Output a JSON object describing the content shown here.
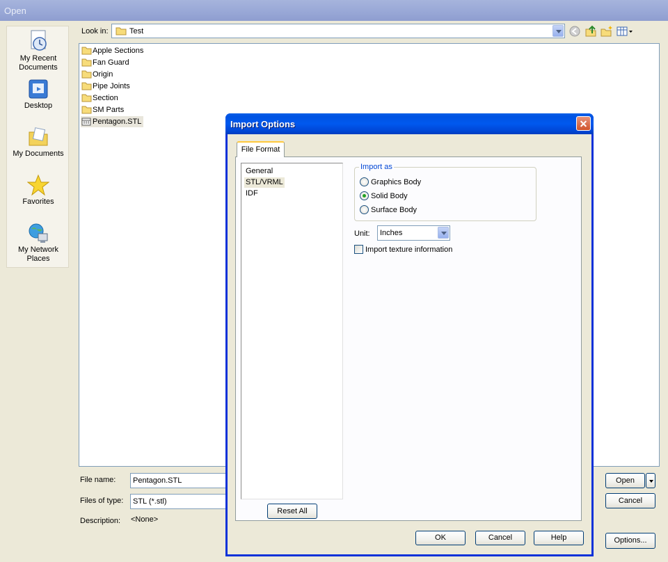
{
  "open_dialog": {
    "title": "Open",
    "places": [
      {
        "label": "My Recent Documents",
        "icon": "recent-documents-icon"
      },
      {
        "label": "Desktop",
        "icon": "desktop-icon"
      },
      {
        "label": "My Documents",
        "icon": "my-documents-icon"
      },
      {
        "label": "Favorites",
        "icon": "favorites-star-icon"
      },
      {
        "label": "My Network Places",
        "icon": "network-places-icon"
      }
    ],
    "look_in": {
      "label": "Look in:",
      "value": "Test"
    },
    "files": [
      {
        "name": "Apple Sections",
        "type": "folder"
      },
      {
        "name": "Fan Guard",
        "type": "folder"
      },
      {
        "name": "Origin",
        "type": "folder"
      },
      {
        "name": "Pipe Joints",
        "type": "folder"
      },
      {
        "name": "Section",
        "type": "folder"
      },
      {
        "name": "SM Parts",
        "type": "folder"
      },
      {
        "name": "Pentagon.STL",
        "type": "stl-file",
        "selected": true
      }
    ],
    "file_name": {
      "label": "File name:",
      "value": "Pentagon.STL"
    },
    "files_of_type": {
      "label": "Files of type:",
      "value": "STL (*.stl)"
    },
    "description": {
      "label": "Description:",
      "value": "<None>"
    },
    "buttons": {
      "open": "Open",
      "cancel": "Cancel",
      "options": "Options..."
    }
  },
  "import_options": {
    "title": "Import Options",
    "tab": "File Format",
    "categories": [
      {
        "label": "General",
        "selected": false
      },
      {
        "label": "STL/VRML",
        "selected": true
      },
      {
        "label": "IDF",
        "selected": false
      }
    ],
    "reset_all": "Reset All",
    "import_as": {
      "title": "Import as",
      "options": [
        {
          "label": "Graphics Body",
          "checked": false
        },
        {
          "label": "Solid Body",
          "checked": true
        },
        {
          "label": "Surface Body",
          "checked": false
        }
      ]
    },
    "unit": {
      "label": "Unit:",
      "value": "Inches"
    },
    "texture_checkbox": {
      "label": "Import texture information",
      "checked": false
    },
    "buttons": {
      "ok": "OK",
      "cancel": "Cancel",
      "help": "Help"
    }
  },
  "colors": {
    "xp_title_blue": "#0054e3",
    "dialog_face": "#ece9d8",
    "close_red": "#d0542d",
    "tab_highlight": "#ffc83c",
    "radio_green": "#21a121"
  }
}
